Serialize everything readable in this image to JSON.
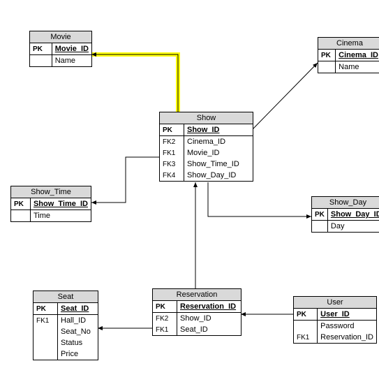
{
  "diagram_type": "ER Diagram",
  "entities": {
    "movie": {
      "title": "Movie",
      "pk_label": "PK",
      "pk_attr": "Movie_ID",
      "attrs": [
        {
          "key": "",
          "name": "Name"
        }
      ]
    },
    "cinema": {
      "title": "Cinema",
      "pk_label": "PK",
      "pk_attr": "Cinema_ID",
      "attrs": [
        {
          "key": "",
          "name": "Name"
        }
      ]
    },
    "show": {
      "title": "Show",
      "pk_label": "PK",
      "pk_attr": "Show_ID",
      "attrs": [
        {
          "key": "FK2",
          "name": "Cinema_ID"
        },
        {
          "key": "FK1",
          "name": "Movie_ID"
        },
        {
          "key": "FK3",
          "name": "Show_Time_ID"
        },
        {
          "key": "FK4",
          "name": "Show_Day_ID"
        }
      ]
    },
    "show_time": {
      "title": "Show_Time",
      "pk_label": "PK",
      "pk_attr": "Show_Time_ID",
      "attrs": [
        {
          "key": "",
          "name": "Time"
        }
      ]
    },
    "show_day": {
      "title": "Show_Day",
      "pk_label": "PK",
      "pk_attr": "Show_Day_ID",
      "attrs": [
        {
          "key": "",
          "name": "Day"
        }
      ]
    },
    "seat": {
      "title": "Seat",
      "pk_label": "PK",
      "pk_attr": "Seat_ID",
      "attrs": [
        {
          "key": "FK1",
          "name": "Hall_ID"
        },
        {
          "key": "",
          "name": "Seat_No"
        },
        {
          "key": "",
          "name": "Status"
        },
        {
          "key": "",
          "name": "Price"
        }
      ]
    },
    "reservation": {
      "title": "Reservation",
      "pk_label": "PK",
      "pk_attr": "Reservation_ID",
      "attrs": [
        {
          "key": "FK2",
          "name": "Show_ID"
        },
        {
          "key": "FK1",
          "name": "Seat_ID"
        }
      ]
    },
    "user": {
      "title": "User",
      "pk_label": "PK",
      "pk_attr": "User_ID",
      "attrs": [
        {
          "key": "",
          "name": "Password"
        },
        {
          "key": "FK1",
          "name": "Reservation_ID"
        }
      ]
    }
  },
  "highlight_color": "#ffff00",
  "relationships": [
    {
      "from": "Show.Movie_ID",
      "to": "Movie.Movie_ID",
      "highlighted": true
    },
    {
      "from": "Show.Cinema_ID",
      "to": "Cinema.Cinema_ID"
    },
    {
      "from": "Show.Show_Time_ID",
      "to": "Show_Time.Show_Time_ID"
    },
    {
      "from": "Show.Show_Day_ID",
      "to": "Show_Day.Show_Day_ID"
    },
    {
      "from": "Reservation.Show_ID",
      "to": "Show.Show_ID"
    },
    {
      "from": "Reservation.Seat_ID",
      "to": "Seat.Seat_ID"
    },
    {
      "from": "User.Reservation_ID",
      "to": "Reservation.Reservation_ID"
    }
  ]
}
